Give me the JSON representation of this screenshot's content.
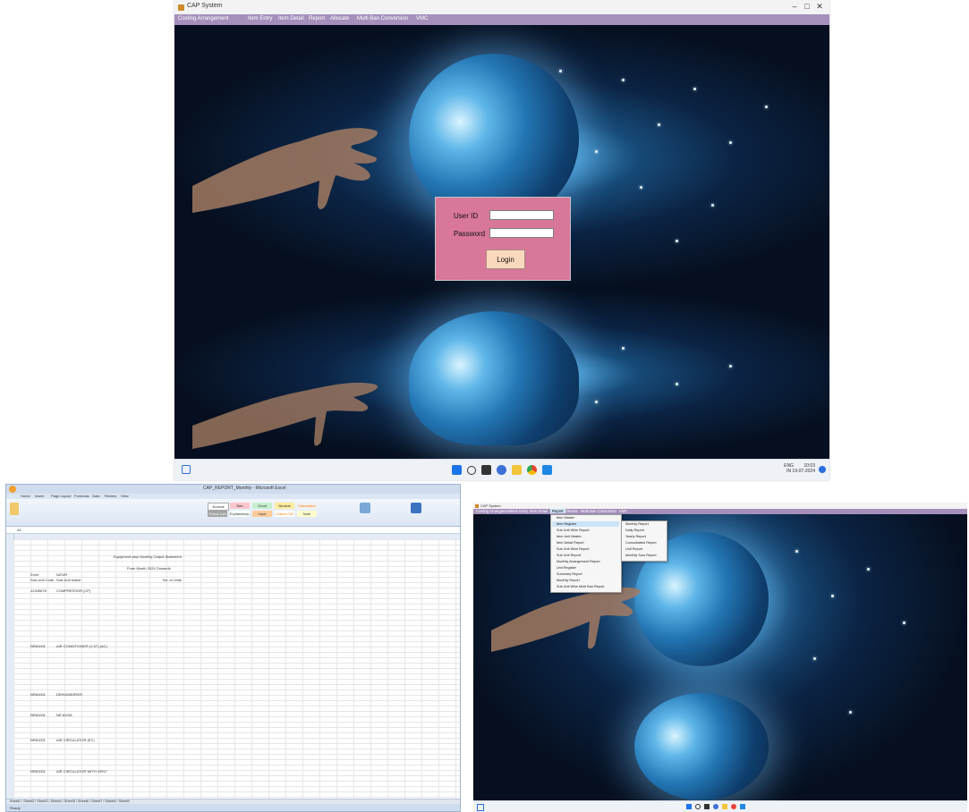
{
  "main_window": {
    "title": "CAP System",
    "controls": [
      "–",
      "□",
      "✕"
    ],
    "menu": [
      "Costing Arrangement",
      "Item Entry",
      "Item Detail",
      "Report",
      "Allocate",
      "Multi Ban Conversion",
      "VMC"
    ],
    "login": {
      "user_label": "User ID",
      "password_label": "Password",
      "user_value": "",
      "password_value": "",
      "login_button": "Login"
    },
    "taskbar": {
      "tray_lang": "ENG",
      "tray_lang2": "IN",
      "time": "10:03",
      "date": "19-07-2024"
    }
  },
  "excel_window": {
    "title": "CAP_REPORT_Monthly - Microsoft Excel",
    "tabs": [
      "Home",
      "Insert",
      "Page Layout",
      "Formulas",
      "Data",
      "Review",
      "View"
    ],
    "styles": [
      "Normal",
      "Bad",
      "Good",
      "Neutral",
      "Calculation",
      "Check Cell",
      "Explanatory...",
      "Input",
      "Linked Cell",
      "Note"
    ],
    "name_box": "A1",
    "report_title": "Equipment wise Monthly Output Statement",
    "report_subtitle": "From Month 2024 Onwards",
    "header_rows": [
      [
        "Zone",
        "NZ/UR"
      ],
      [
        "Sub-Unit Code",
        "Sub-Unit Name",
        "No. of Units"
      ]
    ],
    "groups": [
      {
        "code": "12345678",
        "name": "COMPRESSOR (CP)"
      },
      {
        "code": "NR81001",
        "name": "AIR CONDITIONER (1.5T) (AC)"
      },
      {
        "code": "NR81001",
        "name": "DEHUMIDIFIER"
      },
      {
        "code": "NR81001",
        "name": "NR 81001"
      },
      {
        "code": "NR81001",
        "name": "AIR CIRCULATOR (EC)"
      },
      {
        "code": "NR81001",
        "name": "AIR CIRCULATOR WITH VENT"
      }
    ],
    "sheet_tabs": "Sheet1 / Sheet2 / Sheet3 / Sheet4 / Sheet5 / Sheet6 / Sheet7 / Sheet8 / Sheet9",
    "status": "Ready"
  },
  "menu_window": {
    "title": "CAP System",
    "menu": [
      "Costing Arrangement",
      "Item Entry",
      "Item Detail",
      "Report",
      "Allocate",
      "Multi Ban Conversion",
      "VMC"
    ],
    "report_menu": [
      "Item Master",
      "Item Register",
      "Sub Unit Wise Report",
      "Item Unit Master",
      "Item Detail Report",
      "Sub Unit Wise Report",
      "Sub Unit Report",
      "Monthly Arrangement Report",
      "Unit Register",
      "Summary Report",
      "Monthly Report",
      "Sub Unit Wise Multi Ban Report"
    ],
    "sub_menu": [
      "Monthly Report",
      "Daily Report",
      "Yearly Report",
      "Consolidated Report",
      "Unit Report",
      "Monthly Sum Report"
    ]
  }
}
